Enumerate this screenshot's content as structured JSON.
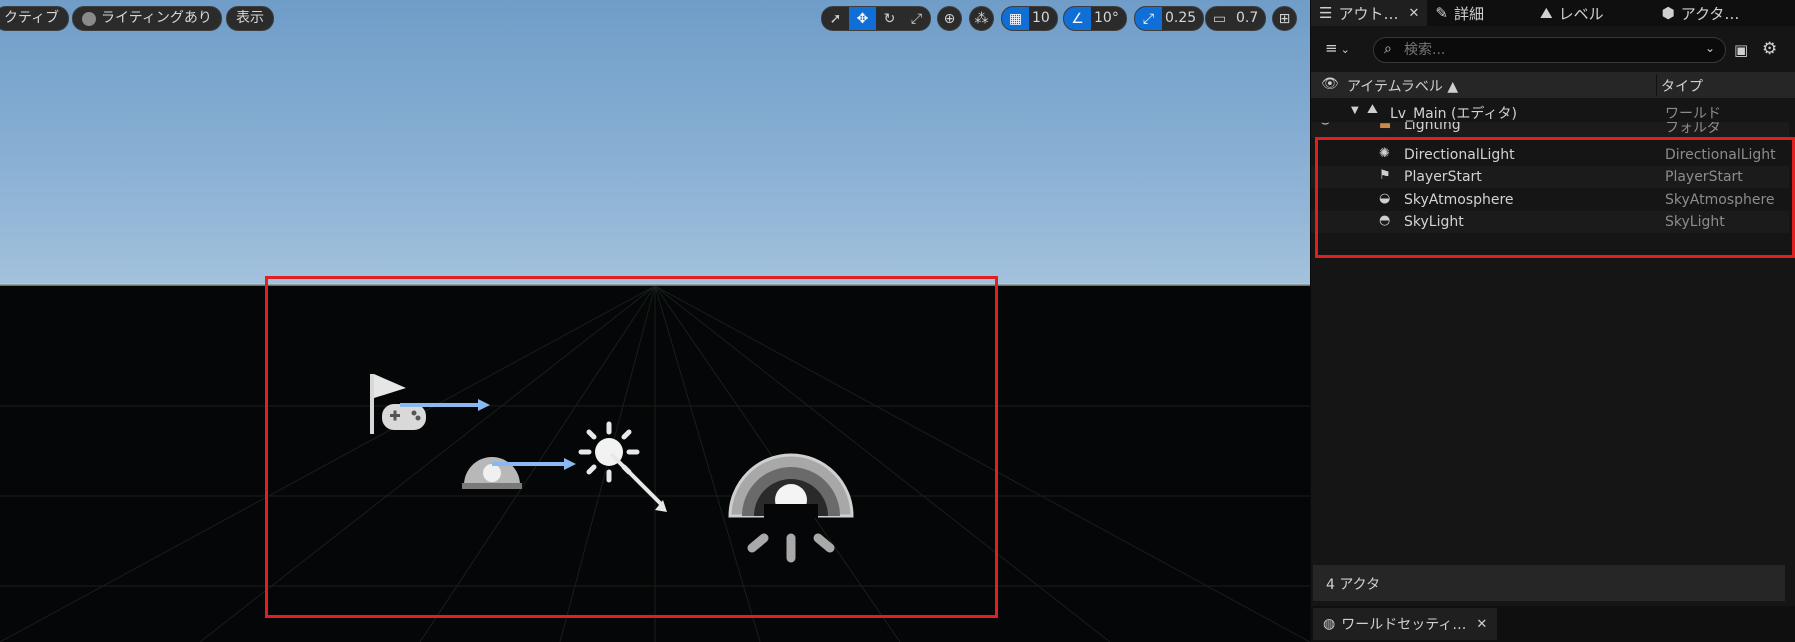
{
  "viewport": {
    "pills": {
      "perspective": "クティブ",
      "lighting": "ライティングあり",
      "show": "表示"
    },
    "toolbar": {
      "grid_snap": "10",
      "rotation_snap": "10°",
      "scale_snap": "0.25",
      "camera_speed": "0.7"
    },
    "accent_color": "#0f6fd6",
    "highlight_color": "#e02020"
  },
  "outliner": {
    "tabs": [
      {
        "label": "アウト…",
        "icon": "outliner-icon"
      },
      {
        "label": "詳細",
        "icon": "pencil-icon"
      },
      {
        "label": "レベル",
        "icon": "level-icon"
      },
      {
        "label": "アクタ…",
        "icon": "actor-icon"
      }
    ],
    "search": {
      "placeholder": "検索..."
    },
    "columns": {
      "label": "アイテムラベル ▲",
      "type": "タイプ"
    },
    "rows": [
      {
        "name": "Lv_Main (エディタ)",
        "type": "ワールド"
      },
      {
        "name": "Lighting",
        "type": "フォルダ"
      },
      {
        "name": "DirectionalLight",
        "type": "DirectionalLight"
      },
      {
        "name": "PlayerStart",
        "type": "PlayerStart"
      },
      {
        "name": "SkyAtmosphere",
        "type": "SkyAtmosphere"
      },
      {
        "name": "SkyLight",
        "type": "SkyLight"
      }
    ],
    "actor_count": "4 アクタ",
    "bottom_tab": "ワールドセッティ…"
  }
}
